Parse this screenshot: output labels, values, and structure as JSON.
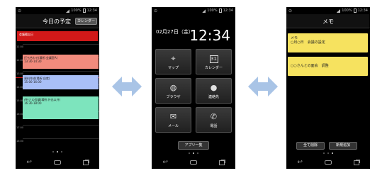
{
  "status": {
    "signal": "100%",
    "time": "12:34"
  },
  "phone1": {
    "title": "今日の予定",
    "calendar_button": "カレンダー",
    "banner": "会議備忘日",
    "times": [
      "11:00",
      "12:00",
      "13:00",
      "14:00",
      "15:00",
      "16:00",
      "17:00",
      "18:00"
    ],
    "events": [
      {
        "title": "打ち合わせ(場所:会議室A)",
        "time": "13:30-14:30"
      },
      {
        "title": "資料作成(場所:自席)",
        "time": "15:00-16:00"
      },
      {
        "title": "A社との会議(場所:外出以外)",
        "time": "16:30-18:00"
      }
    ]
  },
  "phone2": {
    "date": "02月27日（金）",
    "clock": "12:34",
    "tiles": [
      {
        "label": "マップ",
        "icon": "map-icon"
      },
      {
        "label": "カレンダー",
        "icon": "calendar-icon",
        "glyph": "31"
      },
      {
        "label": "ブラウザ",
        "icon": "globe-icon"
      },
      {
        "label": "連絡先",
        "icon": "contact-icon"
      },
      {
        "label": "メール",
        "icon": "mail-icon"
      },
      {
        "label": "電話",
        "icon": "phone-icon"
      }
    ],
    "apps_button": "アプリ一覧"
  },
  "phone3": {
    "title": "メモ",
    "memos": [
      {
        "line1": "メモ",
        "line2": "○月○日　会議の設定"
      },
      {
        "line1": "○○さんとの面会　調整"
      }
    ],
    "delete_all": "全て削除",
    "new_add": "新規追加"
  },
  "colors": {
    "accent_red": "#d11919",
    "event_red": "#f28b7d",
    "event_blue": "#a9bff7",
    "event_green": "#7de4bd",
    "memo_yellow": "#f6e25f",
    "arrow": "#a9c4e6"
  }
}
